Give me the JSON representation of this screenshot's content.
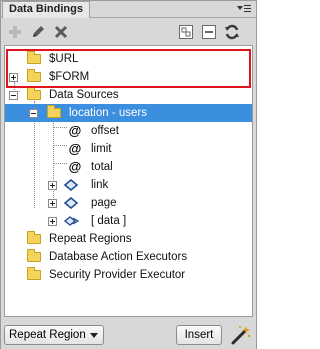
{
  "panel": {
    "title": "Data Bindings"
  },
  "toolbar": {
    "icons": [
      "plus-icon",
      "pencil-icon",
      "delete-icon",
      "expand-all-icon",
      "collapse-all-icon",
      "refresh-icon"
    ]
  },
  "tree": {
    "url": "$URL",
    "form": "$FORM",
    "data_sources": "Data Sources",
    "location_users": "location - users",
    "offset": "offset",
    "limit": "limit",
    "total": "total",
    "link": "link",
    "page": "page",
    "data": "[ data ]",
    "repeat_regions": "Repeat Regions",
    "database_action_executors": "Database Action Executors",
    "security_provider_executor": "Security Provider Executor"
  },
  "bottom": {
    "select_value": "Repeat Region",
    "insert_label": "Insert"
  },
  "colors": {
    "selection": "#3c8fde",
    "highlight_border": "#e0141b",
    "folder": "#f3d35b"
  }
}
